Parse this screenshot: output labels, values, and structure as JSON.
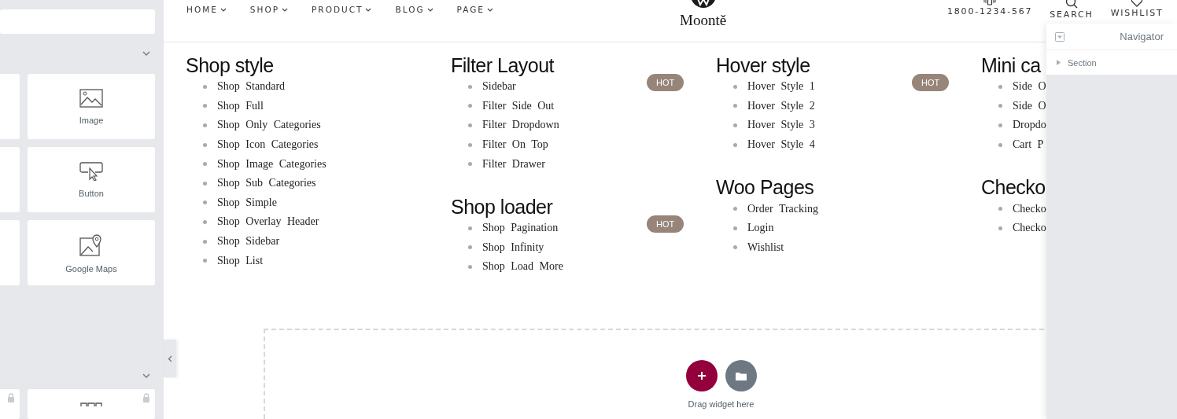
{
  "sidebar": {
    "widgets": [
      {
        "kind": "image",
        "label": "Image"
      },
      {
        "kind": "button",
        "label": "Button"
      },
      {
        "kind": "map",
        "label": "Google Maps"
      }
    ],
    "locked_widgets": [
      {
        "kind": "grid",
        "locked": true
      }
    ]
  },
  "header": {
    "nav": [
      "HOME",
      "SHOP",
      "PRODUCT",
      "BLOG",
      "PAGE"
    ],
    "logo": "Moontě",
    "phone": "1800-1234-567",
    "actions": [
      {
        "kind": "search",
        "label": "SEARCH"
      },
      {
        "kind": "wishlist",
        "label": "WISHLIST"
      }
    ]
  },
  "menu_columns": [
    {
      "groups": [
        {
          "title": "Shop style",
          "hot": false,
          "items": [
            "Shop Standard",
            "Shop Full",
            "Shop Only Categories",
            "Shop Icon Categories",
            "Shop Image Categories",
            "Shop Sub Categories",
            "Shop Simple",
            "Shop Overlay Header",
            "Shop Sidebar",
            "Shop List"
          ]
        }
      ]
    },
    {
      "groups": [
        {
          "title": "Filter Layout",
          "hot": true,
          "badge": "HOT",
          "items": [
            "Sidebar",
            "Filter Side Out",
            "Filter Dropdown",
            "Filter On Top",
            "Filter Drawer"
          ]
        },
        {
          "title": "Shop loader",
          "hot": true,
          "badge": "HOT",
          "items": [
            "Shop Pagination",
            "Shop Infinity",
            "Shop Load More"
          ]
        }
      ]
    },
    {
      "groups": [
        {
          "title": "Hover style",
          "hot": true,
          "badge": "HOT",
          "items": [
            "Hover Style 1",
            "Hover Style 2",
            "Hover Style 3",
            "Hover Style 4"
          ]
        },
        {
          "title": "Woo Pages",
          "hot": false,
          "items": [
            "Order Tracking",
            "Login",
            "Wishlist"
          ]
        }
      ]
    },
    {
      "groups": [
        {
          "title": "Mini ca",
          "hot": false,
          "items": [
            "Side O",
            "Side O",
            "Dropdo",
            "Cart P"
          ]
        },
        {
          "title": "Checko",
          "hot": false,
          "items": [
            "Checko",
            "Checko"
          ]
        }
      ]
    }
  ],
  "drop_zone": {
    "hint": "Drag widget here"
  },
  "navigator": {
    "title": "Navigator",
    "items": [
      {
        "label": "Section",
        "expanded": false
      }
    ]
  }
}
